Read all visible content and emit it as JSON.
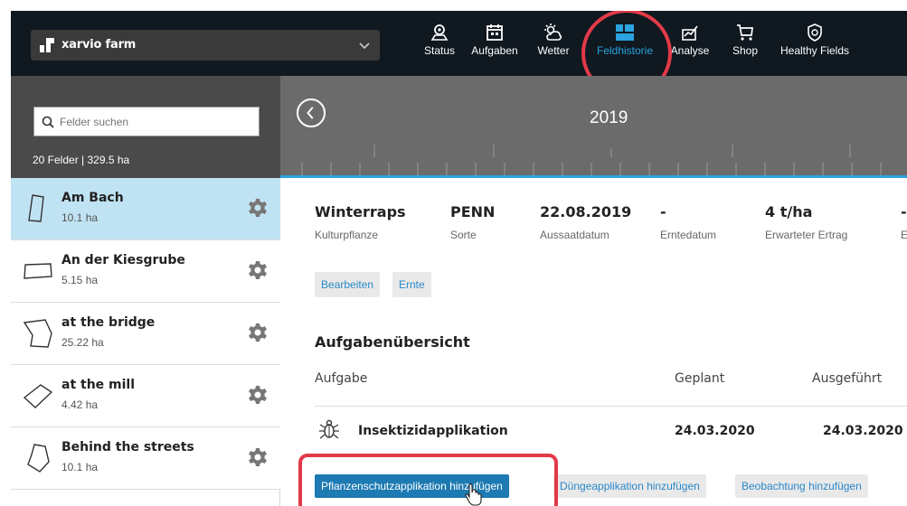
{
  "app": {
    "farm_name": "xarvio farm"
  },
  "nav": [
    {
      "label": "Status",
      "icon": "location-pin-icon",
      "active": false
    },
    {
      "label": "Aufgaben",
      "icon": "calendar-icon",
      "active": false
    },
    {
      "label": "Wetter",
      "icon": "sun-cloud-icon",
      "active": false
    },
    {
      "label": "Feldhistorie",
      "icon": "field-history-icon",
      "active": true
    },
    {
      "label": "Analyse",
      "icon": "chart-icon",
      "active": false
    },
    {
      "label": "Shop",
      "icon": "cart-icon",
      "active": false
    },
    {
      "label": "Healthy Fields",
      "icon": "shield-icon",
      "active": false
    }
  ],
  "sidebar": {
    "search_placeholder": "Felder suchen",
    "summary": "20 Felder | 329.5 ha",
    "fields": [
      {
        "name": "Am Bach",
        "area": "10.1 ha",
        "selected": true
      },
      {
        "name": "An der Kiesgrube",
        "area": "5.15 ha",
        "selected": false
      },
      {
        "name": "at the bridge",
        "area": "25.22 ha",
        "selected": false
      },
      {
        "name": "at the mill",
        "area": "4.42 ha",
        "selected": false
      },
      {
        "name": "Behind the streets",
        "area": "10.1 ha",
        "selected": false
      }
    ]
  },
  "timeline": {
    "year": "2019"
  },
  "crop": {
    "items": [
      {
        "value": "Winterraps",
        "label": "Kulturpflanze"
      },
      {
        "value": "PENN",
        "label": "Sorte"
      },
      {
        "value": "22.08.2019",
        "label": "Aussaatdatum"
      },
      {
        "value": "-",
        "label": "Erntedatum"
      },
      {
        "value": "4 t/ha",
        "label": "Erwarteter Ertrag"
      },
      {
        "value": "-",
        "label": "E"
      }
    ],
    "edit_label": "Bearbeiten",
    "harvest_label": "Ernte"
  },
  "tasks": {
    "title": "Aufgabenübersicht",
    "col_task": "Aufgabe",
    "col_planned": "Geplant",
    "col_done": "Ausgeführt",
    "rows": [
      {
        "name": "Insektizidapplikation",
        "planned": "24.03.2020",
        "done": "24.03.2020",
        "icon": "bug-icon"
      }
    ],
    "add_plant_protection": "Pflanzenschutzapplikation hinzufügen",
    "add_fertilizer": "Düngeapplikation hinzufügen",
    "add_observation": "Beobachtung hinzufügen"
  },
  "colors": {
    "topbar": "#101820",
    "accent": "#2aa3e0",
    "highlight": "#e23a48",
    "selected_row": "#bfe3f3",
    "primary_button": "#1d7ab2"
  }
}
